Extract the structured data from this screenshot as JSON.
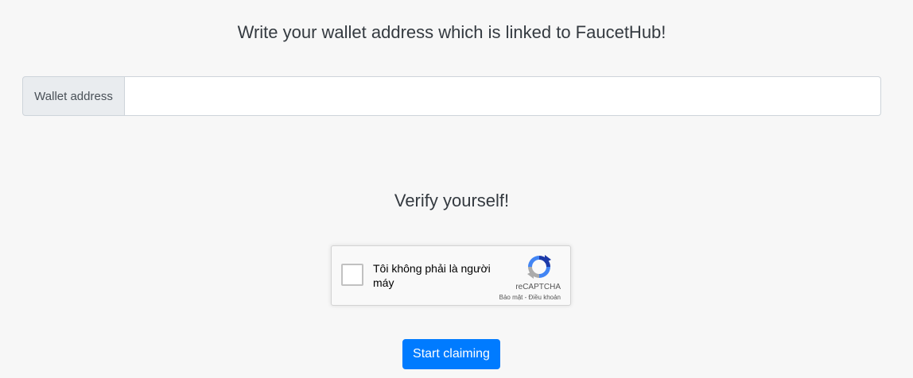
{
  "wallet_section": {
    "heading": "Write your wallet address which is linked to FaucetHub!",
    "input_label": "Wallet address",
    "input_value": "",
    "input_placeholder": ""
  },
  "verify_section": {
    "heading": "Verify yourself!"
  },
  "recaptcha": {
    "checkbox_label": "Tôi không phải là người máy",
    "brand": "reCAPTCHA",
    "privacy_link": "Bảo mật",
    "separator": " - ",
    "terms_link": "Điều khoản",
    "icon": "recaptcha-logo-icon"
  },
  "submit_button": {
    "label": "Start claiming",
    "color": "#007bff"
  }
}
